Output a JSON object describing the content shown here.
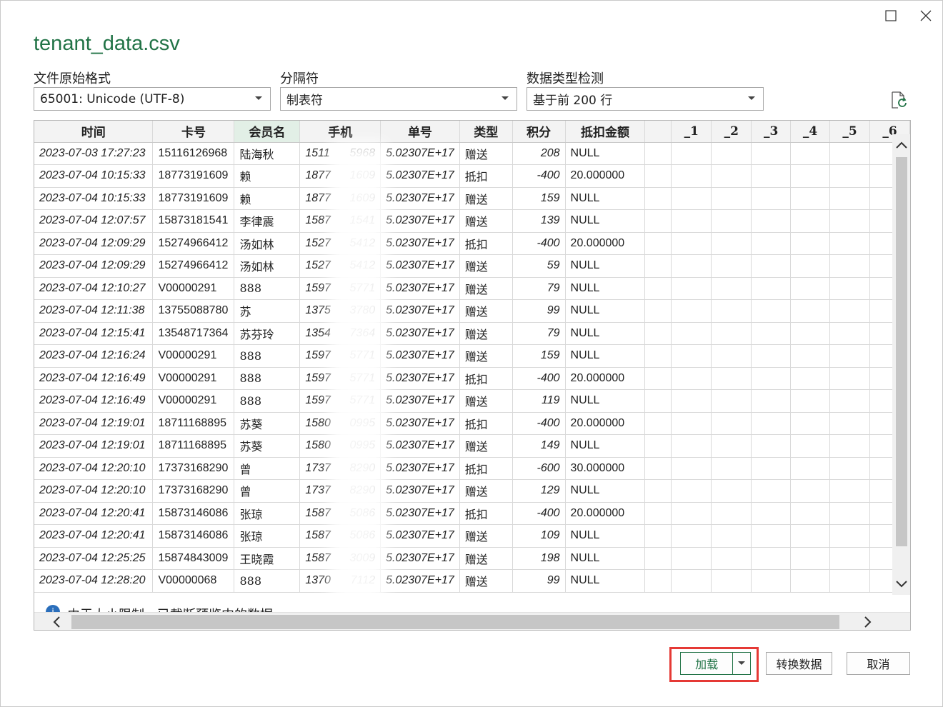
{
  "window": {
    "title": "tenant_data.csv"
  },
  "settings": {
    "origin_label": "文件原始格式",
    "origin_value": "65001: Unicode (UTF-8)",
    "delimiter_label": "分隔符",
    "delimiter_value": "制表符",
    "detect_label": "数据类型检测",
    "detect_value": "基于前 200 行"
  },
  "table": {
    "columns": [
      "时间",
      "卡号",
      "会员名",
      "手机",
      "单号",
      "类型",
      "积分",
      "抵扣金额",
      "",
      "_1",
      "_2",
      "_3",
      "_4",
      "_5",
      "_6"
    ],
    "rows": [
      [
        "2023-07-03 17:27:23",
        "15116126968",
        "陆海秋",
        "1511",
        "5968",
        "5.02307E+17",
        "赠送",
        "208",
        "NULL"
      ],
      [
        "2023-07-04 10:15:33",
        "18773191609",
        "赖",
        "1877",
        "1609",
        "5.02307E+17",
        "抵扣",
        "-400",
        "20.000000"
      ],
      [
        "2023-07-04 10:15:33",
        "18773191609",
        "赖",
        "1877",
        "1609",
        "5.02307E+17",
        "赠送",
        "159",
        "NULL"
      ],
      [
        "2023-07-04 12:07:57",
        "15873181541",
        "李律震",
        "1587",
        "1541",
        "5.02307E+17",
        "赠送",
        "139",
        "NULL"
      ],
      [
        "2023-07-04 12:09:29",
        "15274966412",
        "汤如林",
        "1527",
        "5412",
        "5.02307E+17",
        "抵扣",
        "-400",
        "20.000000"
      ],
      [
        "2023-07-04 12:09:29",
        "15274966412",
        "汤如林",
        "1527",
        "5412",
        "5.02307E+17",
        "赠送",
        "59",
        "NULL"
      ],
      [
        "2023-07-04 12:10:27",
        "V00000291",
        "888",
        "1597",
        "5771",
        "5.02307E+17",
        "赠送",
        "79",
        "NULL"
      ],
      [
        "2023-07-04 12:11:38",
        "13755088780",
        "苏",
        "1375",
        "3780",
        "5.02307E+17",
        "赠送",
        "99",
        "NULL"
      ],
      [
        "2023-07-04 12:15:41",
        "13548717364",
        "苏芬玲",
        "1354",
        "7364",
        "5.02307E+17",
        "赠送",
        "79",
        "NULL"
      ],
      [
        "2023-07-04 12:16:24",
        "V00000291",
        "888",
        "1597",
        "5771",
        "5.02307E+17",
        "赠送",
        "159",
        "NULL"
      ],
      [
        "2023-07-04 12:16:49",
        "V00000291",
        "888",
        "1597",
        "5771",
        "5.02307E+17",
        "抵扣",
        "-400",
        "20.000000"
      ],
      [
        "2023-07-04 12:16:49",
        "V00000291",
        "888",
        "1597",
        "5771",
        "5.02307E+17",
        "赠送",
        "119",
        "NULL"
      ],
      [
        "2023-07-04 12:19:01",
        "18711168895",
        "苏葵",
        "1580",
        "0995",
        "5.02307E+17",
        "抵扣",
        "-400",
        "20.000000"
      ],
      [
        "2023-07-04 12:19:01",
        "18711168895",
        "苏葵",
        "1580",
        "0995",
        "5.02307E+17",
        "赠送",
        "149",
        "NULL"
      ],
      [
        "2023-07-04 12:20:10",
        "17373168290",
        "曾",
        "1737",
        "8290",
        "5.02307E+17",
        "抵扣",
        "-600",
        "30.000000"
      ],
      [
        "2023-07-04 12:20:10",
        "17373168290",
        "曾",
        "1737",
        "8290",
        "5.02307E+17",
        "赠送",
        "129",
        "NULL"
      ],
      [
        "2023-07-04 12:20:41",
        "15873146086",
        "张琼",
        "1587",
        "5086",
        "5.02307E+17",
        "抵扣",
        "-400",
        "20.000000"
      ],
      [
        "2023-07-04 12:20:41",
        "15873146086",
        "张琼",
        "1587",
        "5086",
        "5.02307E+17",
        "赠送",
        "109",
        "NULL"
      ],
      [
        "2023-07-04 12:25:25",
        "15874843009",
        "王晓霞",
        "1587",
        "3009",
        "5.02307E+17",
        "赠送",
        "198",
        "NULL"
      ],
      [
        "2023-07-04 12:28:20",
        "V00000068",
        "888",
        "1370",
        "7112",
        "5.02307E+17",
        "赠送",
        "99",
        "NULL"
      ]
    ]
  },
  "info": {
    "text": "由于大小限制，已截断预览中的数据。"
  },
  "buttons": {
    "load": "加载",
    "transform": "转换数据",
    "cancel": "取消"
  },
  "icons": {
    "maximize": "maximize-icon",
    "close": "close-icon",
    "dropdown": "chevron-down-icon",
    "refresh": "refresh-icon",
    "info": "info-icon"
  },
  "colors": {
    "accent": "#217346",
    "highlight": "#e53935",
    "info": "#2a6ebb"
  }
}
